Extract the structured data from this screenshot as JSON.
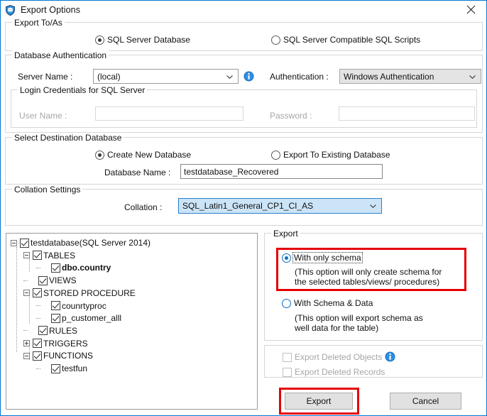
{
  "window": {
    "title": "Export Options",
    "app_icon": "database-shield-icon",
    "close_icon": "close-icon",
    "accent_color": "#0078d7",
    "highlight_color": "#e60000"
  },
  "export_to_as": {
    "legend": "Export To/As",
    "options": [
      {
        "label": "SQL Server Database",
        "selected": true
      },
      {
        "label": "SQL Server Compatible SQL Scripts",
        "selected": false
      }
    ]
  },
  "database_authentication": {
    "legend": "Database Authentication",
    "server_name_label": "Server Name :",
    "server_name_value": "(local)",
    "info_icon": "info-icon",
    "authentication_label": "Authentication :",
    "authentication_value": "Windows Authentication"
  },
  "login_credentials": {
    "legend": "Login Credentials for SQL Server",
    "user_name_label": "User Name :",
    "user_name_value": "",
    "password_label": "Password :",
    "password_value": ""
  },
  "destination_database": {
    "legend": "Select Destination Database",
    "options": [
      {
        "label": "Create New Database",
        "selected": true
      },
      {
        "label": "Export To Existing Database",
        "selected": false
      }
    ],
    "database_name_label": "Database Name :",
    "database_name_value": "testdatabase_Recovered"
  },
  "collation_settings": {
    "legend": "Collation Settings",
    "collation_label": "Collation :",
    "collation_value": "SQL_Latin1_General_CP1_CI_AS"
  },
  "object_tree": {
    "nodes": [
      {
        "label": "testdatabase(SQL Server 2014)",
        "depth": 0,
        "expander": "minus",
        "checked": true,
        "bold": false
      },
      {
        "label": "TABLES",
        "depth": 1,
        "expander": "minus",
        "checked": true,
        "bold": false
      },
      {
        "label": "dbo.country",
        "depth": 2,
        "expander": "none",
        "checked": true,
        "bold": true
      },
      {
        "label": "VIEWS",
        "depth": 1,
        "expander": "none",
        "checked": true,
        "bold": false
      },
      {
        "label": "STORED PROCEDURE",
        "depth": 1,
        "expander": "minus",
        "checked": true,
        "bold": false
      },
      {
        "label": "counrtyproc",
        "depth": 2,
        "expander": "none",
        "checked": true,
        "bold": false
      },
      {
        "label": "p_customer_alll",
        "depth": 2,
        "expander": "none",
        "checked": true,
        "bold": false
      },
      {
        "label": "RULES",
        "depth": 1,
        "expander": "none",
        "checked": true,
        "bold": false
      },
      {
        "label": "TRIGGERS",
        "depth": 1,
        "expander": "plus",
        "checked": true,
        "bold": false
      },
      {
        "label": "FUNCTIONS",
        "depth": 1,
        "expander": "minus",
        "checked": true,
        "bold": false
      },
      {
        "label": "testfun",
        "depth": 2,
        "expander": "none",
        "checked": true,
        "bold": false
      }
    ]
  },
  "export_panel": {
    "legend": "Export",
    "only_schema_label": "With only schema",
    "only_schema_selected": true,
    "only_schema_hint": "(This option will only create schema for\nthe  selected tables/views/ procedures)",
    "schema_data_label": "With Schema & Data",
    "schema_data_selected": false,
    "schema_data_hint": "(This option will export schema as\nwell data for the table)"
  },
  "deleted_options": {
    "export_deleted_objects": "Export Deleted Objects",
    "export_deleted_objects_checked": false,
    "export_deleted_objects_disabled": true,
    "info_icon": "info-icon",
    "export_deleted_records": "Export Deleted Records",
    "export_deleted_records_checked": false,
    "export_deleted_records_disabled": true
  },
  "actions": {
    "export_label": "Export",
    "cancel_label": "Cancel"
  }
}
